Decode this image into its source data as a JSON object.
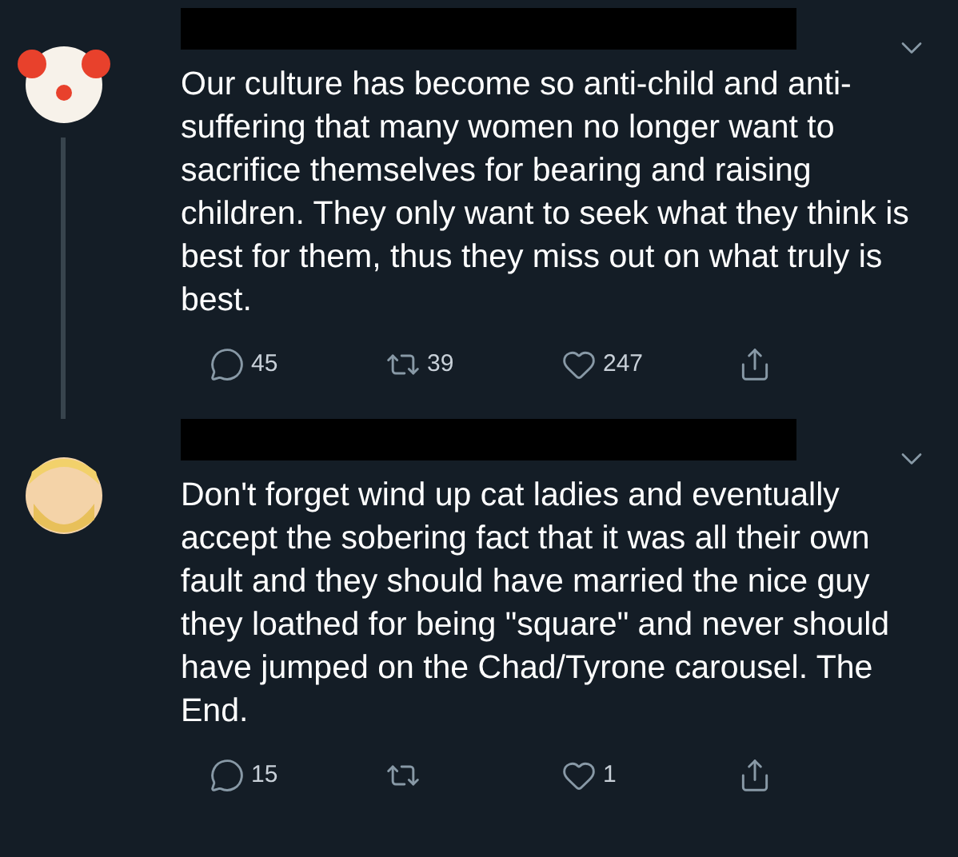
{
  "tweets": [
    {
      "text": "Our culture has become so anti-child and anti-suffering that many women no longer want to sacrifice themselves for bearing and raising children. They only want to seek what they think is best for them, thus they miss out on what truly is best.",
      "thread_continues": true,
      "actions": [
        {
          "kind": "reply",
          "count": "45"
        },
        {
          "kind": "retweet",
          "count": "39"
        },
        {
          "kind": "like",
          "count": "247"
        },
        {
          "kind": "share"
        }
      ]
    },
    {
      "text": "Don't forget wind up cat ladies and eventually accept the sobering fact that it was all their own fault and they should have married the nice guy they loathed for being \"square\" and never should have jumped on the Chad/Tyrone carousel. The End.",
      "thread_continues": false,
      "actions": [
        {
          "kind": "reply",
          "count": "15"
        },
        {
          "kind": "retweet"
        },
        {
          "kind": "like",
          "count": "1"
        },
        {
          "kind": "share"
        }
      ]
    }
  ]
}
